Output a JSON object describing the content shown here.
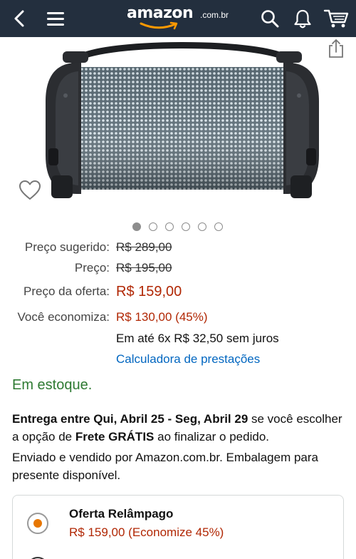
{
  "header": {
    "logo_word": "amazon",
    "logo_tld": ".com.br"
  },
  "gallery": {
    "image_count": 6,
    "active_index": 0
  },
  "pricing": {
    "suggested_label": "Preço sugerido:",
    "suggested_value": "R$ 289,00",
    "price_label": "Preço:",
    "price_value": "R$ 195,00",
    "offer_label": "Preço da oferta:",
    "offer_value": "R$ 159,00",
    "savings_label": "Você economiza:",
    "savings_value": "R$ 130,00 (45%)",
    "installments": "Em até 6x R$ 32,50 sem juros",
    "calculator_link": "Calculadora de prestações"
  },
  "stock_status": "Em estoque.",
  "delivery": {
    "bold_range": "Entrega entre Qui, Abril 25 - Seg, Abril 29",
    "text_mid": " se você escolher a opção de ",
    "bold_free": "Frete GRÁTIS",
    "text_end": " ao finalizar o pedido."
  },
  "seller_text": "Enviado e vendido por Amazon.com.br. Embalagem para presente disponível.",
  "offer_options": {
    "flash_title": "Oferta Relâmpago",
    "flash_price": "R$ 159,00 (Economize 45%)"
  },
  "colors": {
    "header_bg": "#232f3e",
    "price_red": "#b12704",
    "link_blue": "#0066c0",
    "stock_green": "#2e7a32",
    "radio_orange": "#e77600"
  }
}
